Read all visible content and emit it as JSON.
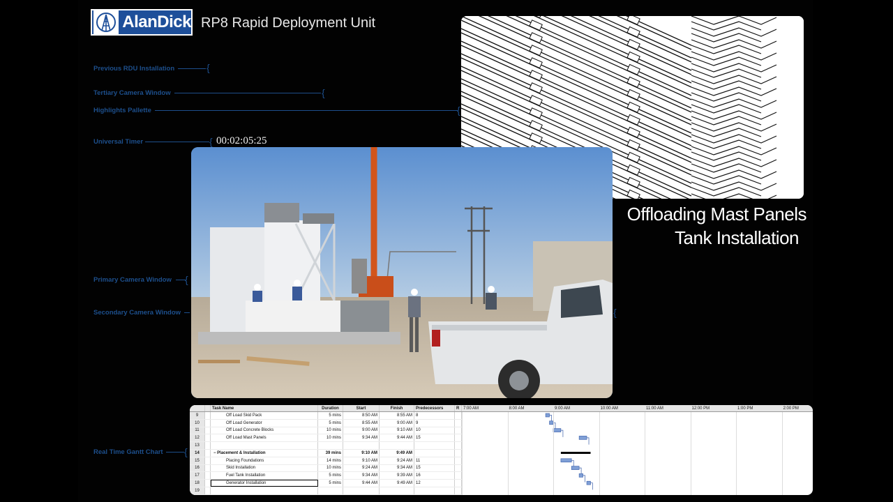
{
  "header": {
    "logo_text": "AlanDick",
    "title": "RP8 Rapid Deployment Unit"
  },
  "annotations": {
    "previous": "Previous RDU Installation",
    "tertiary": "Tertiary Camera Window",
    "highlights": "Highlights Pallette",
    "timer_label": "Universal Timer",
    "primary": "Primary Camera Window",
    "secondary": "Secondary Camera Window",
    "gantt": "Real Time Gantt Chart"
  },
  "timer": "00:02:05:25",
  "caption": {
    "line1": "Offloading Mast Panels",
    "line2": "Tank Installation"
  },
  "colors": {
    "annotation": "#1d4f8c",
    "logo_bg": "#1e4f9a",
    "gantt_bar": "#7f9fd6"
  },
  "gantt": {
    "columns": {
      "name": "Task Name",
      "duration": "Duration",
      "start": "Start",
      "finish": "Finish",
      "predecessors": "Predecessors",
      "r": "R"
    },
    "time_ticks": [
      "7:00 AM",
      "8:00 AM",
      "9:00 AM",
      "10:00 AM",
      "11:00 AM",
      "12:00 PM",
      "1:00 PM",
      "2:00 PM"
    ],
    "rows": [
      {
        "id": "9",
        "name": "Off Load Skid Pack",
        "duration": "5 mins",
        "start": "8:50 AM",
        "finish": "8:55 AM",
        "pred": "8"
      },
      {
        "id": "10",
        "name": "Off Load Generator",
        "duration": "5 mins",
        "start": "8:55 AM",
        "finish": "9:00 AM",
        "pred": "9"
      },
      {
        "id": "11",
        "name": "Off Load Concrete Blocks",
        "duration": "10 mins",
        "start": "9:00 AM",
        "finish": "9:10 AM",
        "pred": "10"
      },
      {
        "id": "12",
        "name": "Off Load Mast Panels",
        "duration": "10 mins",
        "start": "9:34 AM",
        "finish": "9:44 AM",
        "pred": "15"
      },
      {
        "id": "13",
        "name": "",
        "duration": "",
        "start": "",
        "finish": "",
        "pred": ""
      },
      {
        "id": "14",
        "name": "Placement & Installation",
        "duration": "39 mins",
        "start": "9:10 AM",
        "finish": "9:49 AM",
        "pred": "",
        "summary": true
      },
      {
        "id": "15",
        "name": "Placing Foundations",
        "duration": "14 mins",
        "start": "9:10 AM",
        "finish": "9:24 AM",
        "pred": "11"
      },
      {
        "id": "16",
        "name": "Skid Installation",
        "duration": "10 mins",
        "start": "9:24 AM",
        "finish": "9:34 AM",
        "pred": "15"
      },
      {
        "id": "17",
        "name": "Fuel Tank Installation",
        "duration": "5 mins",
        "start": "9:34 AM",
        "finish": "9:39 AM",
        "pred": "16"
      },
      {
        "id": "18",
        "name": "Generator Installation",
        "duration": "5 mins",
        "start": "9:44 AM",
        "finish": "9:49 AM",
        "pred": "12",
        "selected": true
      },
      {
        "id": "19",
        "name": "",
        "duration": "",
        "start": "",
        "finish": "",
        "pred": ""
      }
    ]
  }
}
